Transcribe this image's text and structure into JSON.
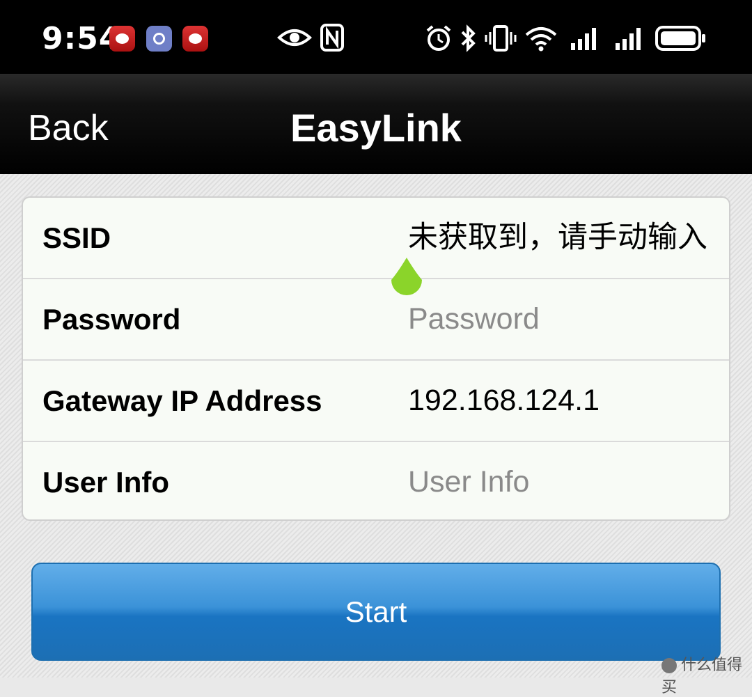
{
  "status_bar": {
    "time": "9:54",
    "icons": [
      "notification-app-icon",
      "notification-app-icon",
      "notification-app-icon",
      "eye-icon",
      "nfc-icon",
      "alarm-icon",
      "bluetooth-icon",
      "vibrate-icon",
      "wifi-6-icon",
      "signal-icon",
      "signal-icon",
      "battery-icon"
    ]
  },
  "nav": {
    "back_label": "Back",
    "title": "EasyLink"
  },
  "form": {
    "rows": [
      {
        "label": "SSID",
        "value": "未获取到，请手动输入",
        "is_placeholder": false
      },
      {
        "label": "Password",
        "value": "Password",
        "is_placeholder": true
      },
      {
        "label": "Gateway IP Address",
        "value": "192.168.124.1",
        "is_placeholder": false
      },
      {
        "label": "User Info",
        "value": "User Info",
        "is_placeholder": true
      }
    ]
  },
  "start_label": "Start",
  "watermark": "什么值得买",
  "colors": {
    "accent": "#2a85cf",
    "cursor_handle": "#8bd42a"
  }
}
